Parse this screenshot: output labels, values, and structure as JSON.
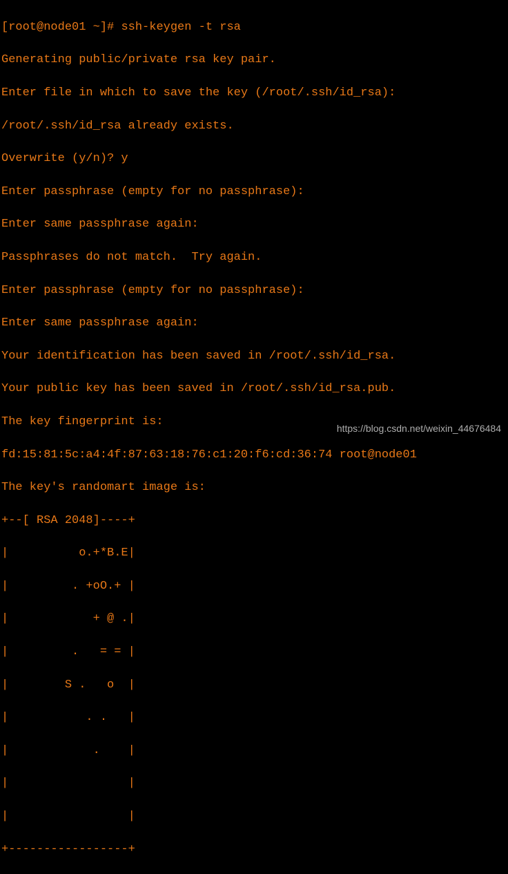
{
  "terminal": {
    "prompt": "[root@node01 ~]# ",
    "command": "ssh-keygen -t rsa",
    "lines": [
      "Generating public/private rsa key pair.",
      "Enter file in which to save the key (/root/.ssh/id_rsa):",
      "/root/.ssh/id_rsa already exists.",
      "Overwrite (y/n)? y",
      "Enter passphrase (empty for no passphrase):",
      "Enter same passphrase again:",
      "Passphrases do not match.  Try again.",
      "Enter passphrase (empty for no passphrase):",
      "Enter same passphrase again:",
      "Your identification has been saved in /root/.ssh/id_rsa.",
      "Your public key has been saved in /root/.ssh/id_rsa.pub.",
      "The key fingerprint is:",
      "fd:15:81:5c:a4:4f:87:63:18:76:c1:20:f6:cd:36:74 root@node01",
      "The key's randomart image is:",
      "+--[ RSA 2048]----+",
      "|          o.+*B.E|",
      "|         . +oO.+ |",
      "|            + @ .|",
      "|         .   = = |",
      "|        S .   o  |",
      "|           . .   |",
      "|            .    |",
      "|                 |",
      "|                 |",
      "+-----------------+"
    ]
  },
  "watermark": "https://blog.csdn.net/weixin_44676484"
}
